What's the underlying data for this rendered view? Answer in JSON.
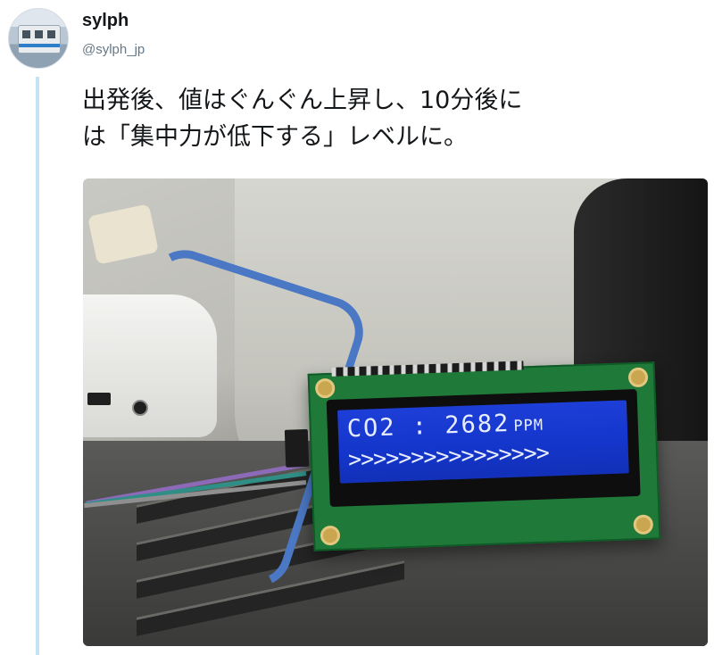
{
  "user": {
    "display_name": "sylph",
    "screen_name": "@sylph_jp"
  },
  "tweet": {
    "lines": [
      "出発後、値はぐんぐん上昇し、10分後に",
      "は「集中力が低下する」レベルに。"
    ]
  },
  "photo": {
    "lcd": {
      "line1_label": "CO2 : 2682",
      "line1_unit": "PPM",
      "line2": ">>>>>>>>>>>>>>>>",
      "backlight_color": "#1d3fd8",
      "text_color": "#e8edff"
    }
  },
  "colors": {
    "thread_line": "#c4e3f5",
    "display_name": "#14171a",
    "screen_name": "#657786"
  }
}
